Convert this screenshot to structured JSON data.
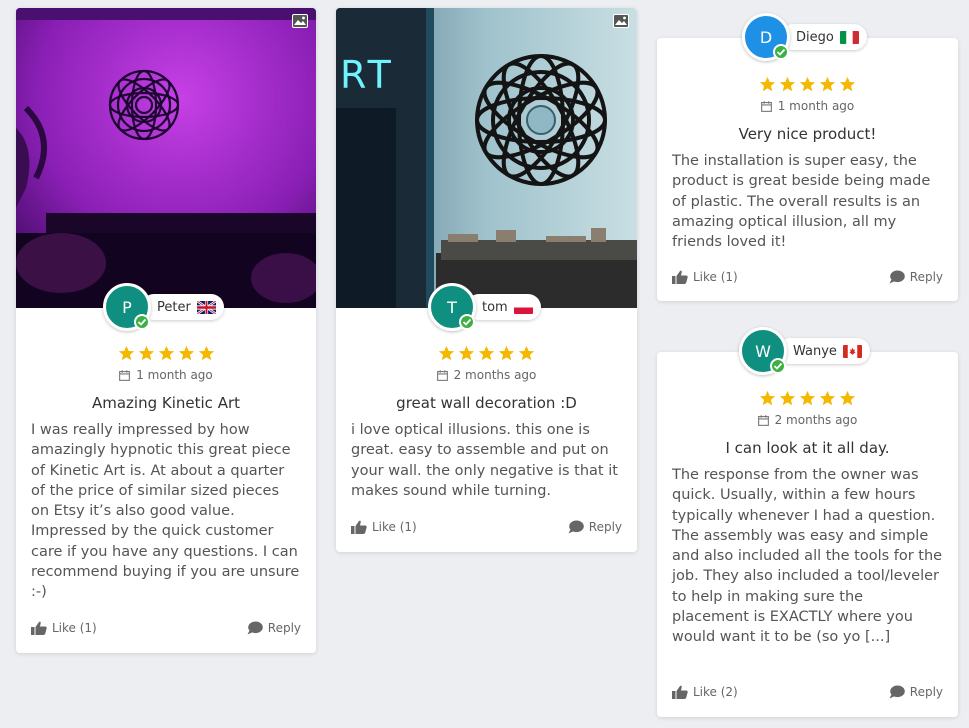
{
  "reviews": [
    {
      "initial": "P",
      "name": "Peter",
      "flag": "uk-flag",
      "avatar_color": "#0f8f80",
      "date": "1 month ago",
      "title": "Amazing Kinetic Art",
      "text": "I was really impressed by how amazingly hypnotic this great piece of Kinetic Art is. At about a quarter of the price of similar sized pieces on Etsy it’s also good value. Impressed by the quick customer care if you have any questions. I can recommend buying if you are unsure :-)",
      "like_label": "Like (1)",
      "reply_label": "Reply",
      "rating": 5,
      "has_photo": true
    },
    {
      "initial": "T",
      "name": "tom",
      "flag": "poland-flag",
      "avatar_color": "#0f8f80",
      "date": "2 months ago",
      "title": "great wall decoration :D",
      "text": "i love optical illusions. this one is great. easy to assemble and put on your wall. the only negative is that it makes sound while turning.",
      "like_label": "Like (1)",
      "reply_label": "Reply",
      "rating": 5,
      "has_photo": true,
      "sign_text": "RT"
    },
    {
      "initial": "D",
      "name": "Diego",
      "flag": "italy-flag",
      "avatar_color": "#1e90e6",
      "date": "1 month ago",
      "title": "Very nice product!",
      "text": "The installation is super easy, the product is great beside being made of plastic. The overall results is an amazing optical illusion, all my friends loved it!",
      "like_label": "Like (1)",
      "reply_label": "Reply",
      "rating": 5,
      "has_photo": false
    },
    {
      "initial": "W",
      "name": "Wanye",
      "flag": "canada-flag",
      "avatar_color": "#0f8f80",
      "date": "2 months ago",
      "title": "I can look at it all day.",
      "text": "The response from the owner was quick. Usually, within a few hours typically whenever I had a question. The assembly was easy and simple and also included all the tools for the job. They also included a tool/leveler to help in making sure the placement is EXACTLY where you would want it to be (so yo [...]",
      "like_label": "Like (2)",
      "reply_label": "Reply",
      "rating": 5,
      "has_photo": false
    }
  ],
  "colors": {
    "star": "#f5b800",
    "verified": "#3cb043",
    "background": "#eceef2"
  }
}
